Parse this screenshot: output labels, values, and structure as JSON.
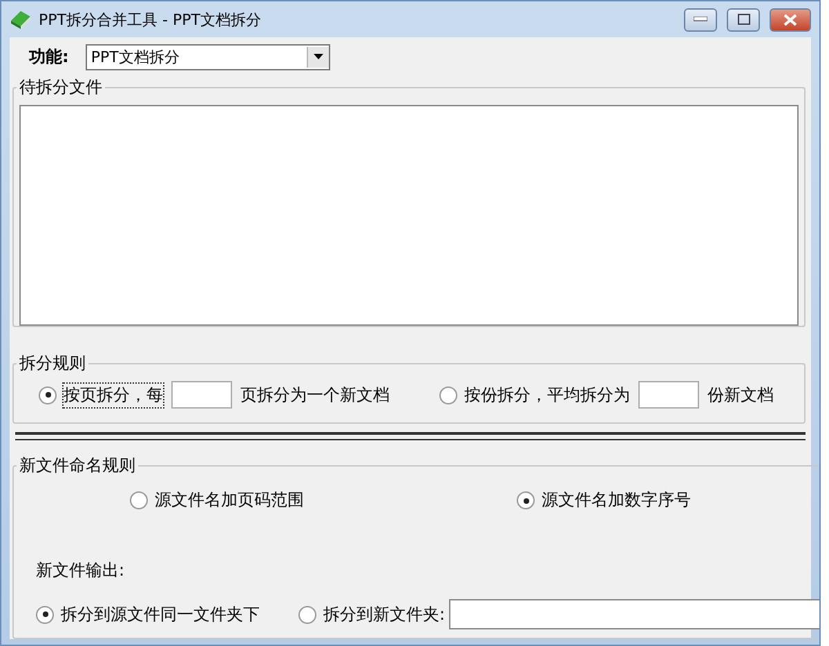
{
  "window": {
    "title": "PPT拆分合并工具 - PPT文档拆分"
  },
  "function_row": {
    "label": "功能:",
    "value": "PPT文档拆分"
  },
  "files_group": {
    "title": "待拆分文件"
  },
  "split_rule": {
    "title": "拆分规则",
    "options": [
      {
        "selected": true,
        "focused": true,
        "label_before": "按页拆分，每",
        "label_after": "页拆分为一个新文档"
      },
      {
        "selected": false,
        "focused": false,
        "label_before": "按份拆分，平均拆分为",
        "label_after": "份新文档"
      }
    ]
  },
  "naming_rule": {
    "title": "新文件命名规则",
    "options": [
      {
        "label": "源文件名加页码范围",
        "selected": false
      },
      {
        "label": "源文件名加数字序号",
        "selected": true
      }
    ],
    "output_label": "新文件输出:",
    "output_options": [
      {
        "kind": "plain",
        "label": "拆分到源文件同一文件夹下",
        "selected": true
      },
      {
        "kind": "folder",
        "label": "拆分到新文件夹:",
        "selected": false
      }
    ]
  }
}
